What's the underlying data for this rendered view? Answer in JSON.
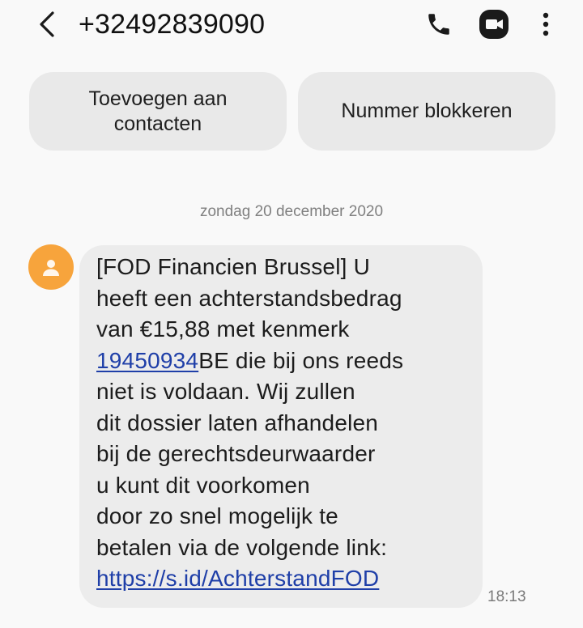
{
  "header": {
    "back_icon": "chevron-left-icon",
    "contact": "+32492839090",
    "call_icon": "phone-icon",
    "video_icon": "video-camera-icon",
    "more_icon": "more-vertical-icon"
  },
  "actions": {
    "add_contact_label": "Toevoegen aan\ncontacten",
    "block_label": "Nummer blokkeren"
  },
  "conversation": {
    "date_header": "zondag 20 december 2020",
    "message": {
      "avatar_icon": "person-icon",
      "avatar_color": "#f7a43c",
      "text_part1": "[FOD Financien Brussel] U\nheeft een achterstandsbedrag\nvan €15,88 met kenmerk\n",
      "reference_link": "19450934",
      "text_part2": "BE die bij ons reeds\nniet is voldaan. Wij zullen\ndit dossier laten afhandelen\nbij de gerechtsdeurwaarder\nu kunt dit voorkomen\ndoor zo snel mogelijk te\nbetalen via de volgende link:\n",
      "url_link": "https://s.id/AchterstandFOD",
      "link_color": "#1f3fa8",
      "time": "18:13"
    }
  }
}
